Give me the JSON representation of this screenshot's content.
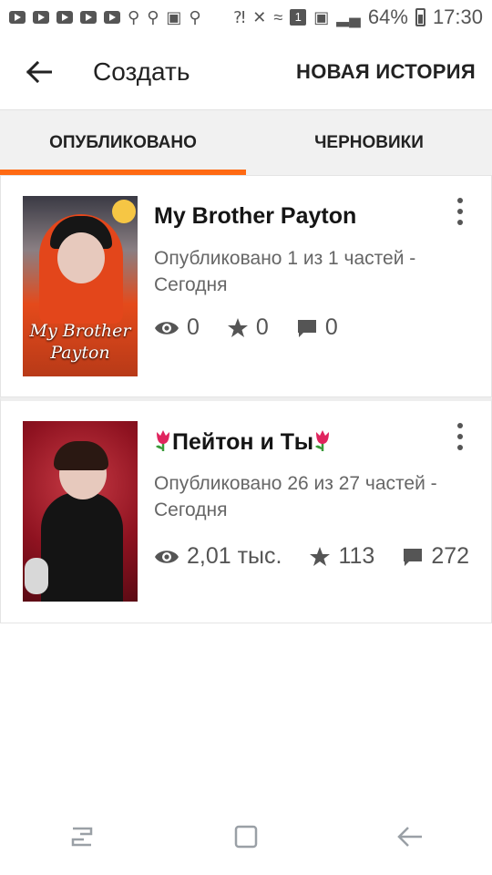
{
  "status_bar": {
    "battery": "64%",
    "time": "17:30",
    "sim_badge": "1"
  },
  "appbar": {
    "title": "Создать",
    "new_story_label": "НОВАЯ ИСТОРИЯ"
  },
  "tabs": [
    {
      "label": "ОПУБЛИКОВАНО",
      "active": true
    },
    {
      "label": "ЧЕРНОВИКИ",
      "active": false
    }
  ],
  "stories": [
    {
      "title": "My Brother Payton",
      "cover_text_line1": "My Brother",
      "cover_text_line2": "Payton",
      "meta": "Опубликовано 1 из 1 частей - Сегодня",
      "views": "0",
      "votes": "0",
      "comments": "0"
    },
    {
      "title": "Пейтон и Ты",
      "meta": "Опубликовано 26 из 27 частей - Сегодня",
      "views": "2,01 тыс.",
      "votes": "113",
      "comments": "272"
    }
  ],
  "colors": {
    "accent": "#ff6a13",
    "tab_bg": "#f1f1f1",
    "text_primary": "#151515",
    "text_secondary": "#666666"
  }
}
